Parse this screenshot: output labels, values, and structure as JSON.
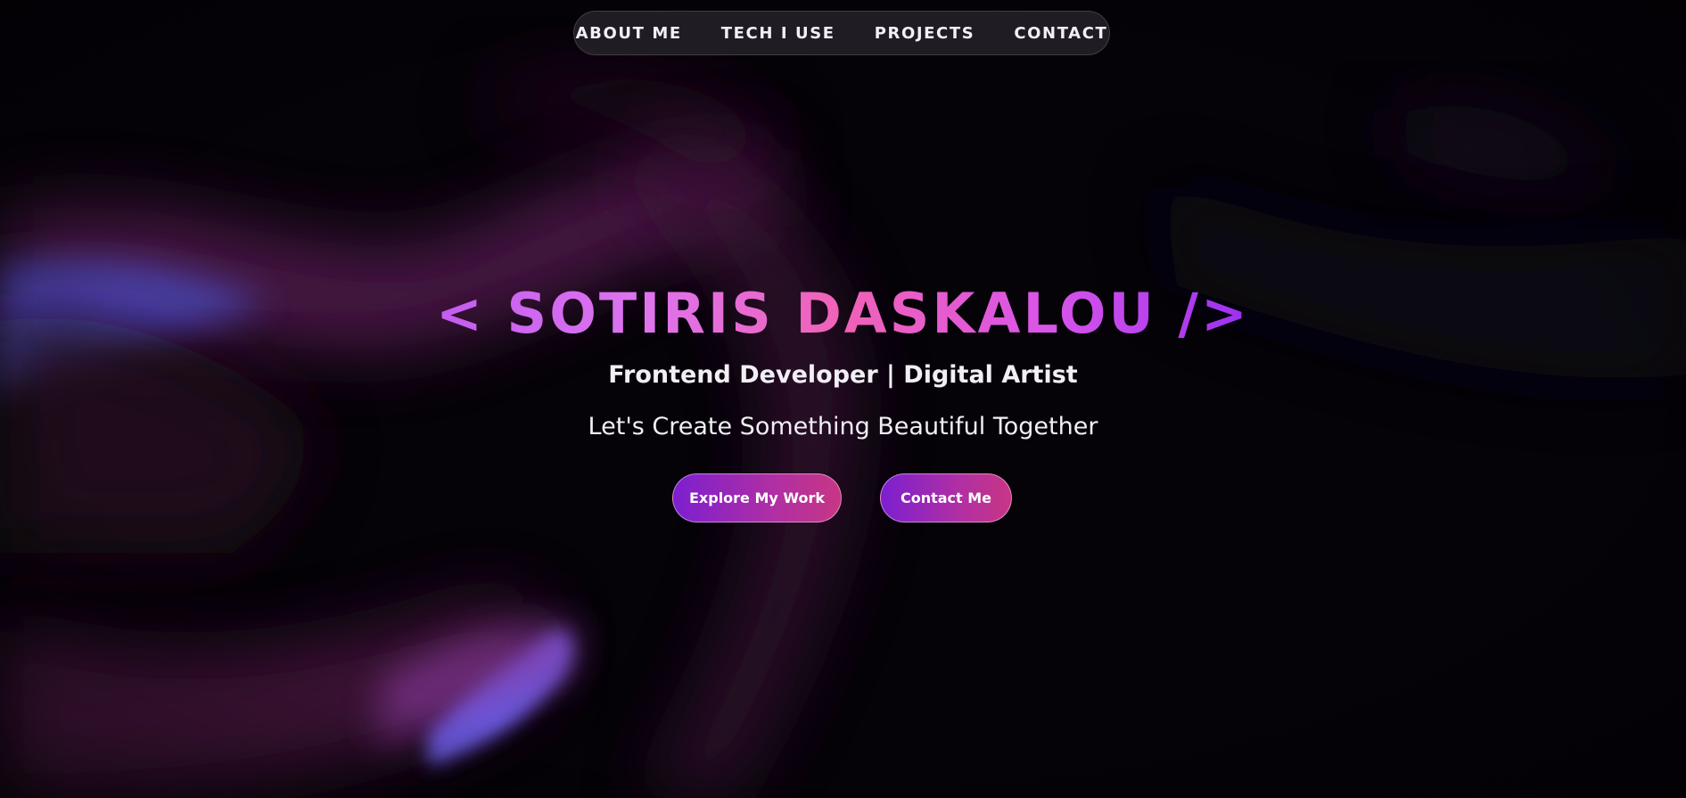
{
  "nav": {
    "items": [
      {
        "label": "ABOUT ME"
      },
      {
        "label": "TECH I USE"
      },
      {
        "label": "PROJECTS"
      },
      {
        "label": "CONTACT"
      }
    ]
  },
  "hero": {
    "title": "< SOTIRIS DASKALOU />",
    "subtitle": "Frontend Developer | Digital Artist",
    "tagline": "Let's Create Something Beautiful Together",
    "buttons": {
      "explore_label": "Explore My Work",
      "contact_label": "Contact Me"
    }
  },
  "colors": {
    "background": "#040206",
    "accent_purple": "#7c1fd0",
    "accent_pink": "#c83685",
    "title_gradient_start": "#c35cf0",
    "title_gradient_end": "#9b30f0",
    "nav_background": "#222026"
  }
}
